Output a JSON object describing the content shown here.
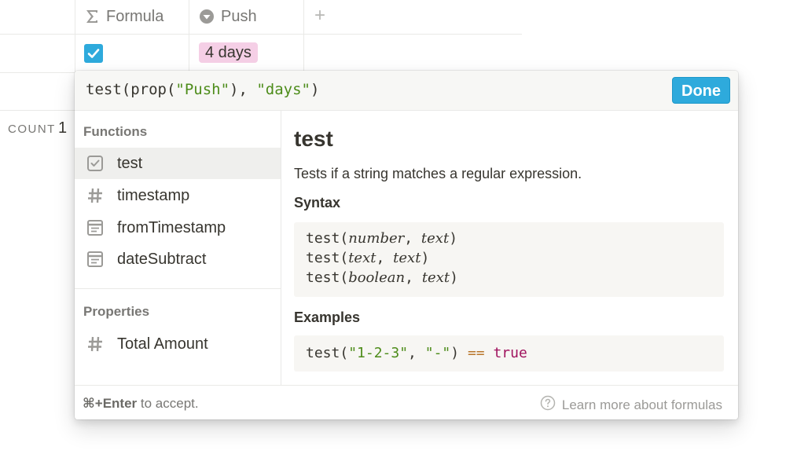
{
  "table": {
    "columns": [
      {
        "label": "Formula",
        "icon": "sigma-icon"
      },
      {
        "label": "Push",
        "icon": "select-arrow-icon"
      }
    ],
    "add_column_label": "+",
    "row": {
      "checkbox_checked": true,
      "push_tag": "4 days",
      "tag_color": "#f5cfe6"
    },
    "count_label": "COUNT",
    "count_value": "1"
  },
  "formula_editor": {
    "expression_parts": {
      "p1": "test(prop(",
      "s1": "\"Push\"",
      "p2": "), ",
      "s2": "\"days\"",
      "p3": ")"
    },
    "done_label": "Done",
    "accent_color": "#2eaadc",
    "functions_title": "Functions",
    "functions": [
      {
        "label": "test",
        "icon": "checkbox-icon",
        "selected": true
      },
      {
        "label": "timestamp",
        "icon": "hash-icon"
      },
      {
        "label": "fromTimestamp",
        "icon": "calendar-icon"
      },
      {
        "label": "dateSubtract",
        "icon": "calendar-icon"
      }
    ],
    "properties_title": "Properties",
    "properties": [
      {
        "label": "Total Amount",
        "icon": "hash-icon"
      }
    ],
    "doc": {
      "title": "test",
      "description": "Tests if a string matches a regular expression.",
      "syntax_title": "Syntax",
      "syntax": [
        {
          "fn": "test(",
          "a": "number",
          "sep": ", ",
          "b": "text",
          "end": ")"
        },
        {
          "fn": "test(",
          "a": "text",
          "sep": ", ",
          "b": "text",
          "end": ")"
        },
        {
          "fn": "test(",
          "a": "boolean",
          "sep": ", ",
          "b": "text",
          "end": ")"
        }
      ],
      "examples_title": "Examples",
      "example": {
        "fn": "test(",
        "arg1": "\"1-2-3\"",
        "sep": ", ",
        "arg2": "\"-\"",
        "close": ") ",
        "op": "==",
        "space": " ",
        "value": "true"
      }
    },
    "footer": {
      "shortcut": "⌘+Enter",
      "hint": " to accept.",
      "learn_more": "Learn more about formulas"
    }
  }
}
